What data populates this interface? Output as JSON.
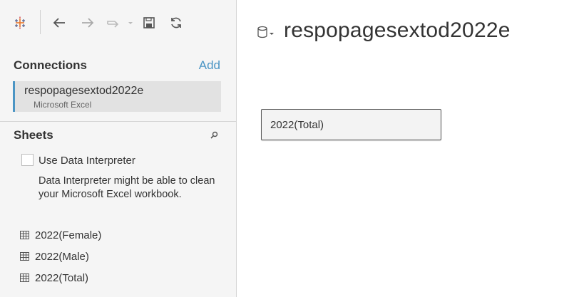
{
  "sidebar": {
    "connections_title": "Connections",
    "add_label": "Add",
    "connection": {
      "name": "respopagesextod2022e",
      "type": "Microsoft Excel"
    },
    "sheets_title": "Sheets",
    "use_interpreter_label": "Use Data Interpreter",
    "interpreter_description": "Data Interpreter might be able to clean your Microsoft Excel workbook.",
    "sheets": [
      {
        "label": "2022(Female)",
        "icon": "table-grid-icon"
      },
      {
        "label": "2022(Male)",
        "icon": "table-grid-icon"
      },
      {
        "label": "2022(Total)",
        "icon": "table-grid-icon"
      }
    ]
  },
  "main": {
    "datasource_title": "respopagesextod2022e",
    "canvas_table": "2022(Total)"
  },
  "colors": {
    "accent": "#4b95c4",
    "sidebar_bg": "#f5f5f5",
    "selected_bg": "#e2e2e2"
  }
}
